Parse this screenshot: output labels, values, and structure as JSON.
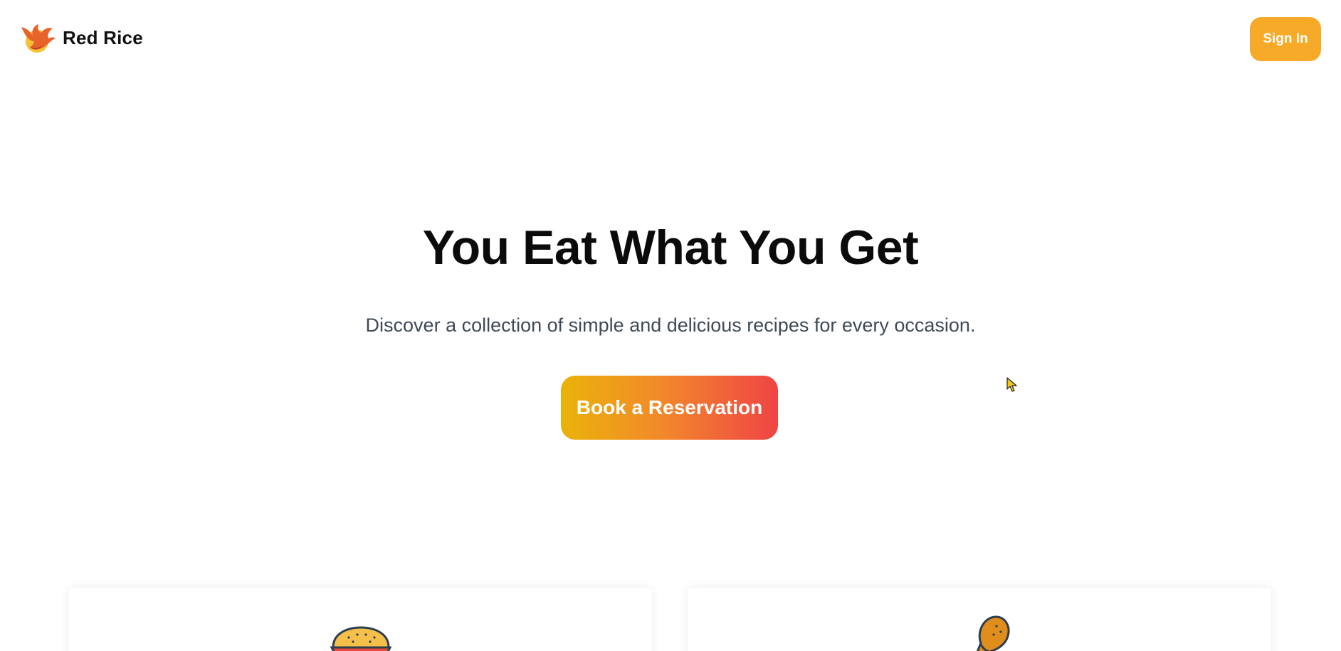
{
  "header": {
    "brand_name": "Red Rice",
    "signin_label": "Sign In"
  },
  "hero": {
    "title": "You Eat What You Get",
    "subtitle": "Discover a collection of simple and delicious recipes for every occasion.",
    "cta_label": "Book a Reservation"
  },
  "cards": [
    {
      "icon": "burger-icon"
    },
    {
      "icon": "chicken-leg-icon"
    }
  ],
  "colors": {
    "accent": "#f7a928",
    "cta_gradient_start": "#eab308",
    "cta_gradient_end": "#ef4444",
    "title": "#0b0b0b",
    "subtitle": "#3f4a56"
  }
}
